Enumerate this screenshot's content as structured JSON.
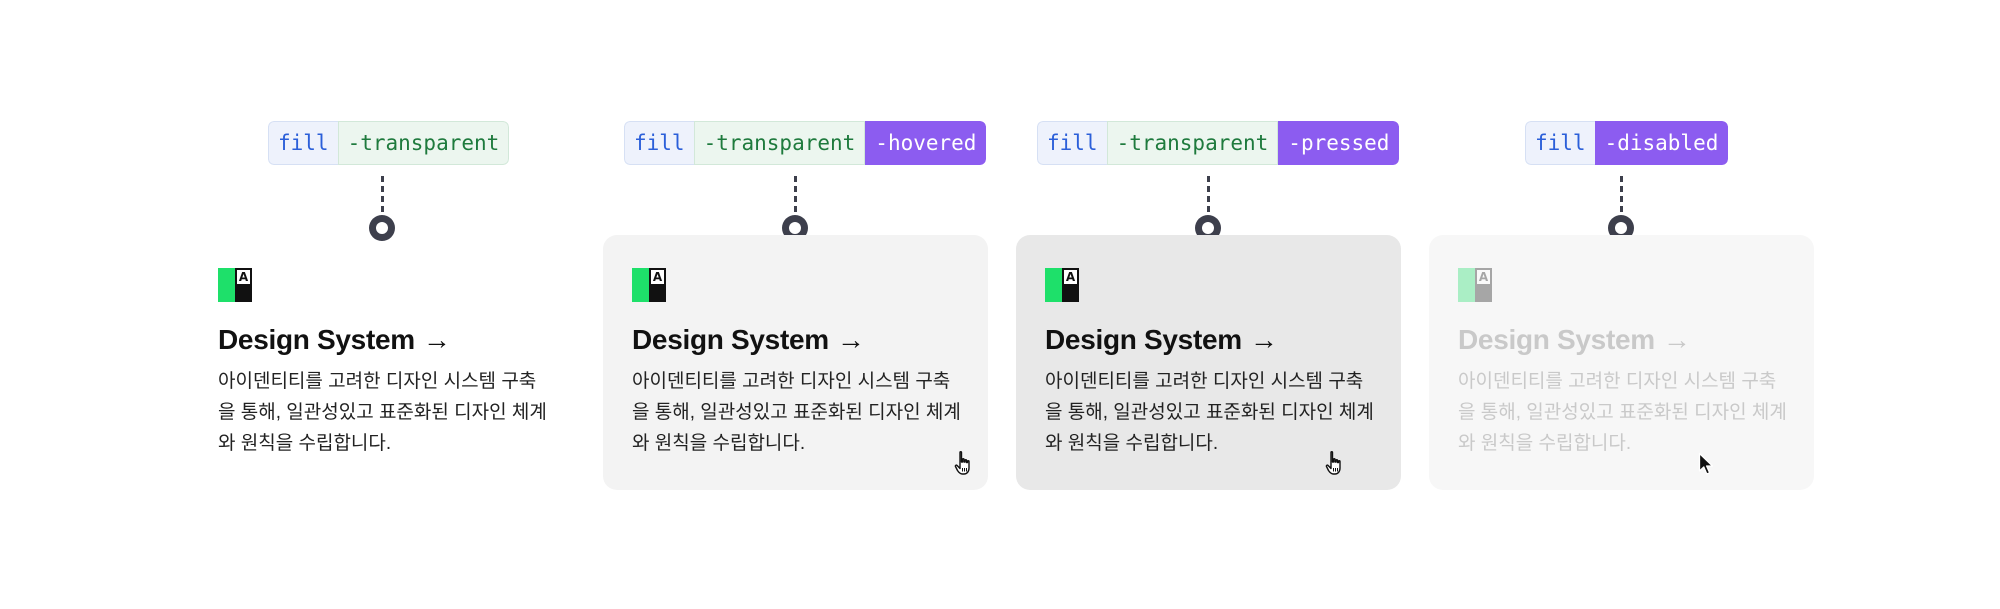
{
  "variants": [
    {
      "tag": {
        "fill": "fill",
        "modifier": "-transparent",
        "state": ""
      },
      "card": {
        "title": "Design System",
        "arrow": "→",
        "description": "아이덴티티를 고려한 디자인 시스템 구축을 통해, 일관성있고 표준화된 디자인 체계와 원칙을 수립합니다.",
        "logo_letter": "A",
        "cursor": "none"
      }
    },
    {
      "tag": {
        "fill": "fill",
        "modifier": "-transparent",
        "state": "-hovered"
      },
      "card": {
        "title": "Design System",
        "arrow": "→",
        "description": "아이덴티티를 고려한 디자인 시스템 구축을 통해, 일관성있고 표준화된 디자인 체계와 원칙을 수립합니다.",
        "logo_letter": "A",
        "cursor": "hand-pointer-icon",
        "background": "#f3f3f3"
      }
    },
    {
      "tag": {
        "fill": "fill",
        "modifier": "-transparent",
        "state": "-pressed"
      },
      "card": {
        "title": "Design System",
        "arrow": "→",
        "description": "아이덴티티를 고려한 디자인 시스템 구축을 통해, 일관성있고 표준화된 디자인 체계와 원칙을 수립합니다.",
        "logo_letter": "A",
        "cursor": "hand-pointer-icon",
        "background": "#e8e8e8"
      }
    },
    {
      "tag": {
        "fill": "fill",
        "modifier": "",
        "state": "-disabled"
      },
      "card": {
        "title": "Design System",
        "arrow": "→",
        "description": "아이덴티티를 고려한 디자인 시스템 구축을 통해, 일관성있고 표준화된 디자인 체계와 원칙을 수립합니다.",
        "logo_letter": "A",
        "cursor": "arrow-pointer-icon",
        "background": "#f7f7f7"
      }
    }
  ],
  "colors": {
    "fill_token": "#2b5fd9",
    "modifier_token": "#1e7a3d",
    "state_token_bg": "#8c5cf0",
    "connector": "#3d3f4c",
    "logo_green": "#1ee06a",
    "disabled_text": "#c9c9c9"
  }
}
